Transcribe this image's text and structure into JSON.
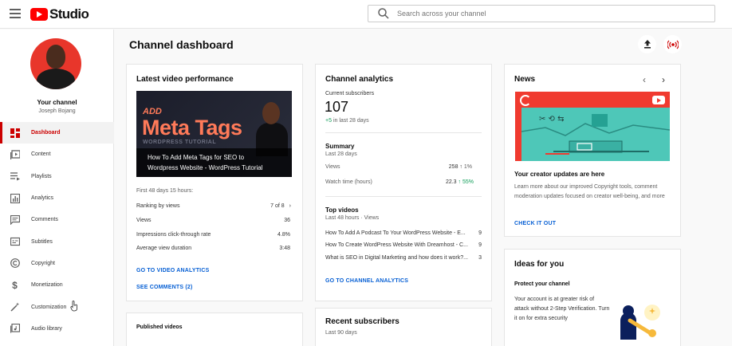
{
  "app": {
    "logo_text": "Studio"
  },
  "search": {
    "placeholder": "Search across your channel"
  },
  "sidebar": {
    "your_channel": "Your channel",
    "channel_name": "Joseph Bojang",
    "items": [
      {
        "label": "Dashboard",
        "icon": "dashboard-icon",
        "active": true
      },
      {
        "label": "Content",
        "icon": "content-icon"
      },
      {
        "label": "Playlists",
        "icon": "playlists-icon"
      },
      {
        "label": "Analytics",
        "icon": "analytics-icon"
      },
      {
        "label": "Comments",
        "icon": "comments-icon"
      },
      {
        "label": "Subtitles",
        "icon": "subtitles-icon"
      },
      {
        "label": "Copyright",
        "icon": "copyright-icon"
      },
      {
        "label": "Monetization",
        "icon": "monetization-icon"
      },
      {
        "label": "Customization",
        "icon": "customization-icon"
      },
      {
        "label": "Audio library",
        "icon": "audio-library-icon"
      }
    ]
  },
  "main": {
    "title": "Channel dashboard"
  },
  "latest": {
    "title": "Latest video performance",
    "thumb_add": "ADD",
    "thumb_meta": "Meta Tags",
    "thumb_wp": "WORDPRESS TUTORIAL",
    "caption_1": "How To Add Meta Tags for SEO to",
    "caption_2": "Wordpress Website - WordPress Tutorial",
    "period": "First 48 days 15 hours:",
    "rows": [
      {
        "label": "Ranking by views",
        "value": "7 of 8"
      },
      {
        "label": "Views",
        "value": "36"
      },
      {
        "label": "Impressions click-through rate",
        "value": "4.8%"
      },
      {
        "label": "Average view duration",
        "value": "3:48"
      }
    ],
    "link_analytics": "GO TO VIDEO ANALYTICS",
    "link_comments": "SEE COMMENTS (2)"
  },
  "analytics": {
    "title": "Channel analytics",
    "subs_label": "Current subscribers",
    "subs_value": "107",
    "subs_delta": "+5",
    "subs_delta_text": "in last 28 days",
    "summary_title": "Summary",
    "summary_period": "Last 28 days",
    "views_label": "Views",
    "views_value": "258",
    "views_pct": "1%",
    "watch_label": "Watch time (hours)",
    "watch_value": "22.3",
    "watch_pct": "55%",
    "top_title": "Top videos",
    "top_period": "Last 48 hours · Views",
    "top_videos": [
      {
        "title": "How To Add A Podcast To Your WordPress Website - E...",
        "views": "9"
      },
      {
        "title": "How To Create WordPress Website With Dreamhost - C...",
        "views": "9"
      },
      {
        "title": "What is SEO in Digital Marketing and how does it work?...",
        "views": "3"
      }
    ],
    "link": "GO TO CHANNEL ANALYTICS"
  },
  "news": {
    "title": "News",
    "headline": "Your creator updates are here",
    "body": "Learn more about our improved Copyright tools, comment moderation updates focused on creator well-being, and more",
    "link": "CHECK IT OUT"
  },
  "ideas": {
    "title": "Ideas for you",
    "subtitle": "Protect your channel",
    "body": "Your account is at greater risk of attack without 2-Step Verification. Turn it on for extra security"
  },
  "published": {
    "title": "Published videos"
  },
  "recent": {
    "title": "Recent subscribers",
    "period": "Last 90 days"
  },
  "colors": {
    "accent": "#cc0000",
    "link": "#065fd4",
    "positive": "#0f9d58"
  }
}
